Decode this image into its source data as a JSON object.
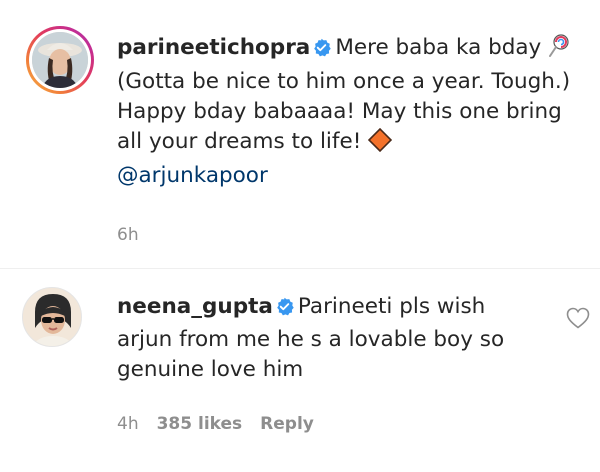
{
  "post": {
    "username": "parineetichopra",
    "text_part1": "Mere baba ka bday ",
    "text_part2": "(Gotta be nice to him once a year. Tough.) Happy bday babaaaa! May this one bring all your dreams to life! ",
    "mention": "@arjunkapoor",
    "time": "6h",
    "icons": [
      "lollipop-icon",
      "orange-diamond-icon",
      "verified-badge-icon"
    ]
  },
  "comment": {
    "username": "neena_gupta",
    "text": "Parineeti pls wish arjun from me he s a lovable boy so genuine love him",
    "time": "4h",
    "likes": "385 likes",
    "reply": "Reply",
    "icons": [
      "verified-badge-icon",
      "heart-outline-icon"
    ]
  },
  "colors": {
    "text": "#262626",
    "muted": "#8e8e8e",
    "verified": "#3897f0",
    "mention": "#00376b",
    "diamond": "#f4722b"
  }
}
